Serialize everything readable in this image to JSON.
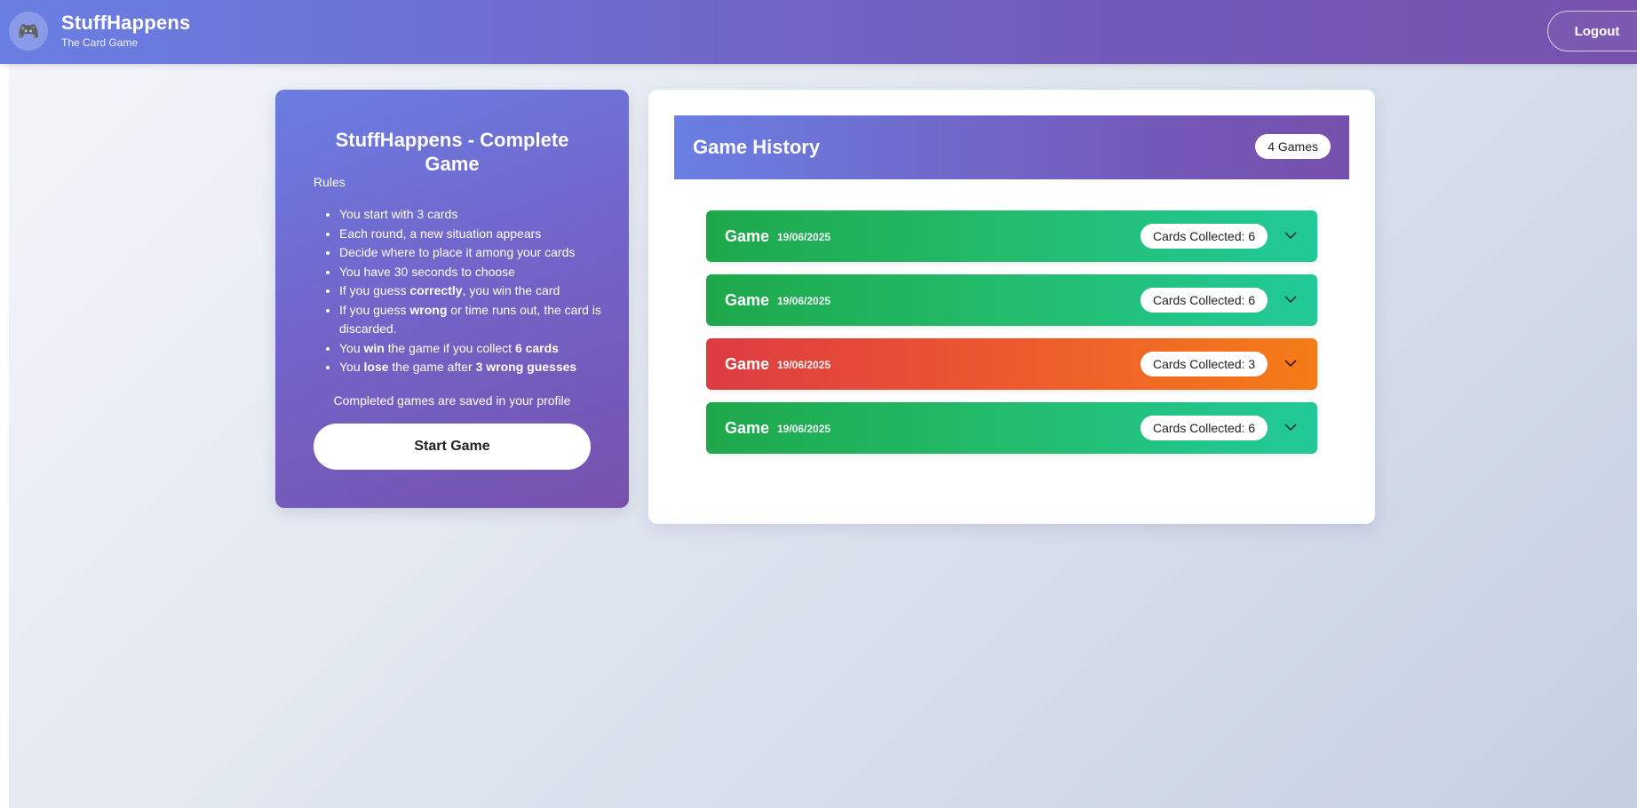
{
  "navbar": {
    "logo_icon": "gamepad-icon",
    "title": "StuffHappens",
    "subtitle": "The Card Game",
    "logout_label": "Logout"
  },
  "rules_card": {
    "title": "StuffHappens - Complete Game",
    "heading": "Rules",
    "items": [
      [
        {
          "t": "You start with 3 cards"
        }
      ],
      [
        {
          "t": "Each round, a new situation appears"
        }
      ],
      [
        {
          "t": "Decide where to place it among your cards"
        }
      ],
      [
        {
          "t": "You have 30 seconds to choose"
        }
      ],
      [
        {
          "t": "If you guess "
        },
        {
          "t": "correctly",
          "b": true
        },
        {
          "t": ", you win the card"
        }
      ],
      [
        {
          "t": "If you guess "
        },
        {
          "t": "wrong",
          "b": true
        },
        {
          "t": " or time runs out, the card is discarded."
        }
      ],
      [
        {
          "t": "You "
        },
        {
          "t": "win",
          "b": true
        },
        {
          "t": " the game if you collect "
        },
        {
          "t": "6 cards",
          "b": true
        }
      ],
      [
        {
          "t": "You "
        },
        {
          "t": "lose",
          "b": true
        },
        {
          "t": " the game after "
        },
        {
          "t": "3 wrong guesses",
          "b": true
        }
      ]
    ],
    "note": "Completed games are saved in your profile",
    "start_label": "Start Game"
  },
  "history": {
    "title": "Game History",
    "count_label": "4 Games",
    "games": [
      {
        "label": "Game",
        "date": "19/06/2025",
        "cards": "Cards Collected: 6",
        "result": "win"
      },
      {
        "label": "Game",
        "date": "19/06/2025",
        "cards": "Cards Collected: 6",
        "result": "win"
      },
      {
        "label": "Game",
        "date": "19/06/2025",
        "cards": "Cards Collected: 3",
        "result": "loss"
      },
      {
        "label": "Game",
        "date": "19/06/2025",
        "cards": "Cards Collected: 6",
        "result": "win"
      }
    ]
  },
  "colors": {
    "brand_start": "#6a7fe3",
    "brand_end": "#7652ae",
    "win_start": "#1ea84a",
    "win_end": "#22c998",
    "loss_start": "#dd3b42",
    "loss_end": "#f57c17"
  }
}
